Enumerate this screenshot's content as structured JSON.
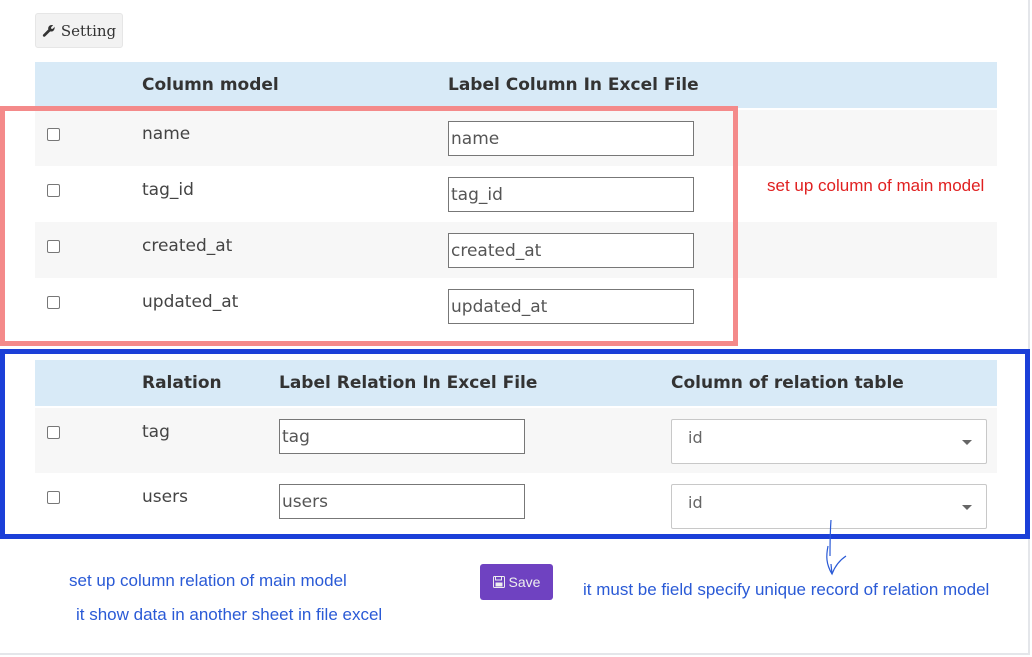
{
  "toolbar": {
    "setting_label": "Setting",
    "setting_icon": "wrench-icon"
  },
  "columns_table": {
    "headers": [
      "Column model",
      "Label Column In Excel File"
    ],
    "rows": [
      {
        "name": "name",
        "label": "name"
      },
      {
        "name": "tag_id",
        "label": "tag_id"
      },
      {
        "name": "created_at",
        "label": "created_at"
      },
      {
        "name": "updated_at",
        "label": "updated_at"
      }
    ]
  },
  "relations_table": {
    "headers": [
      "Ralation",
      "Label Relation In Excel File",
      "Column of relation table"
    ],
    "rows": [
      {
        "name": "tag",
        "label": "tag",
        "column": "id"
      },
      {
        "name": "users",
        "label": "users",
        "column": "id"
      }
    ]
  },
  "annotations": {
    "main_model": "set up column of main model",
    "relation_model": "set up column relation of main model",
    "another_sheet": "it show data in another sheet in file excel",
    "unique_record": "it must be field specify unique record of relation model"
  },
  "save": {
    "label": "Save",
    "icon": "floppy-disk-icon"
  },
  "colors": {
    "header_bg": "#d8eaf7",
    "stripe_bg": "#f7f7f7",
    "red_annotation": "#f48a8a",
    "blue_annotation": "#1b3fd8",
    "save_bg": "#6f42c1"
  }
}
